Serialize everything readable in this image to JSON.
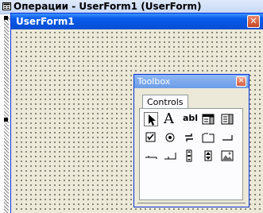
{
  "project_window": {
    "title": "Операции - UserForm1 (UserForm)"
  },
  "userform": {
    "caption": "UserForm1"
  },
  "toolbox": {
    "title": "Toolbox",
    "tab": "Controls",
    "text_glyphs": {
      "label": "A",
      "textbox": "abl"
    },
    "tools": [
      "select-objects-icon",
      "label-icon",
      "textbox-icon",
      "combobox-icon",
      "listbox-icon",
      "checkbox-icon",
      "option-button-icon",
      "toggle-button-icon",
      "frame-icon",
      "command-button-icon",
      "tabstrip-icon",
      "multipage-icon",
      "scrollbar-icon",
      "spinbutton-icon",
      "image-icon"
    ]
  }
}
